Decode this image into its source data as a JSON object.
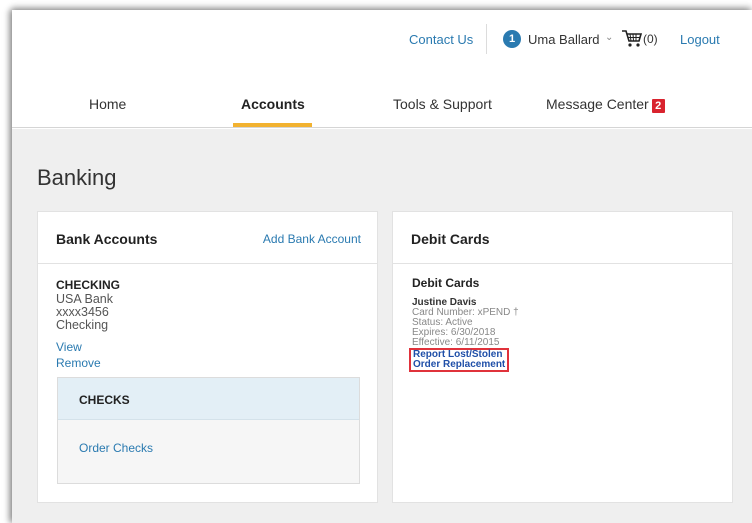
{
  "topbar": {
    "contact": "Contact Us",
    "user_initial": "1",
    "user_name": "Uma Ballard",
    "cart_count": "(0)",
    "logout": "Logout"
  },
  "nav": {
    "home": "Home",
    "accounts": "Accounts",
    "tools": "Tools & Support",
    "messages": "Message Center",
    "message_count": "2"
  },
  "page": {
    "title": "Banking"
  },
  "bank_panel": {
    "title": "Bank Accounts",
    "add_link": "Add Bank Account",
    "account": {
      "type": "CHECKING",
      "bank": "USA Bank",
      "number": "xxxx3456",
      "kind": "Checking",
      "view": "View",
      "remove": "Remove"
    },
    "checks": {
      "title": "CHECKS",
      "order": "Order Checks"
    }
  },
  "debit_panel": {
    "title": "Debit Cards",
    "section_title": "Debit Cards",
    "holder": "Justine Davis",
    "card_number": "Card Number: xPEND †",
    "status": "Status: Active",
    "expires": "Expires: 6/30/2018",
    "effective": "Effective: 6/11/2015",
    "report": "Report Lost/Stolen",
    "replace": "Order Replacement"
  },
  "colors": {
    "link": "#2a7ab0",
    "accent_underline": "#f2b230",
    "badge": "#d9232e",
    "highlight_box": "#e0323b"
  }
}
